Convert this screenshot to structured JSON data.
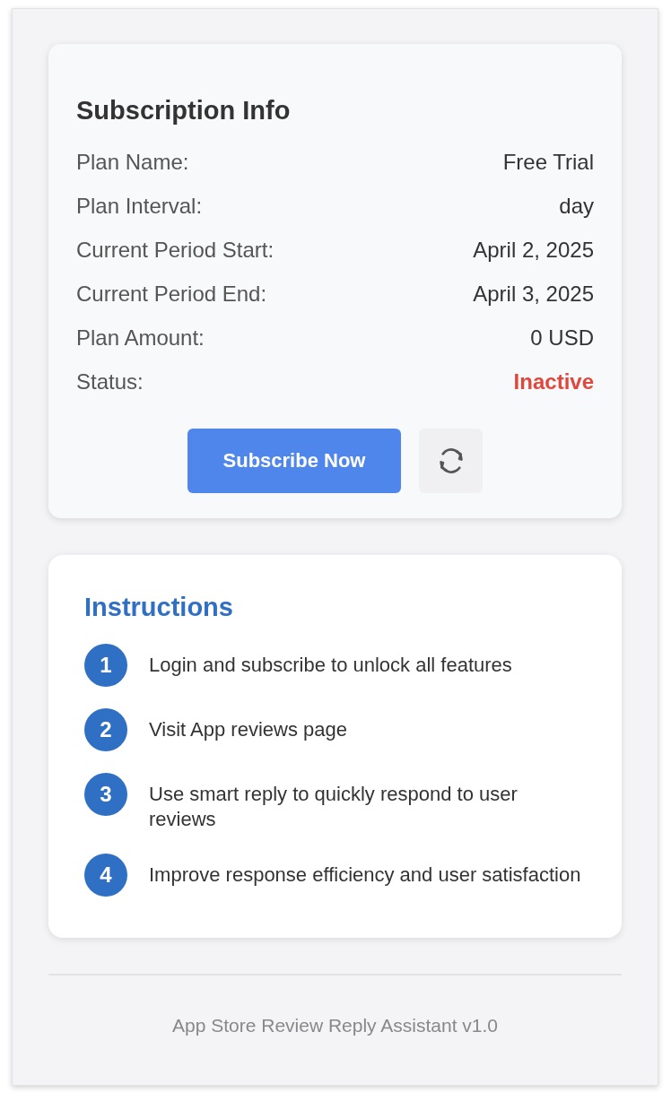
{
  "subscription": {
    "title": "Subscription Info",
    "rows": [
      {
        "label": "Plan Name:",
        "value": "Free Trial",
        "kind": "plain"
      },
      {
        "label": "Plan Interval:",
        "value": "day",
        "kind": "plain"
      },
      {
        "label": "Current Period Start:",
        "value": "April 2, 2025",
        "kind": "plain"
      },
      {
        "label": "Current Period End:",
        "value": "April 3, 2025",
        "kind": "plain"
      },
      {
        "label": "Plan Amount:",
        "value": "0 USD",
        "kind": "plain"
      },
      {
        "label": "Status:",
        "value": "Inactive",
        "kind": "status",
        "active": false
      }
    ],
    "subscribe_button": "Subscribe Now"
  },
  "instructions": {
    "title": "Instructions",
    "steps": [
      {
        "number": "1",
        "text": "Login and subscribe to unlock all features"
      },
      {
        "number": "2",
        "text": "Visit App reviews page"
      },
      {
        "number": "3",
        "text": "Use smart reply to quickly respond to user reviews"
      },
      {
        "number": "4",
        "text": "Improve response efficiency and user satisfaction"
      }
    ]
  },
  "footer": "App Store Review Reply Assistant v1.0"
}
